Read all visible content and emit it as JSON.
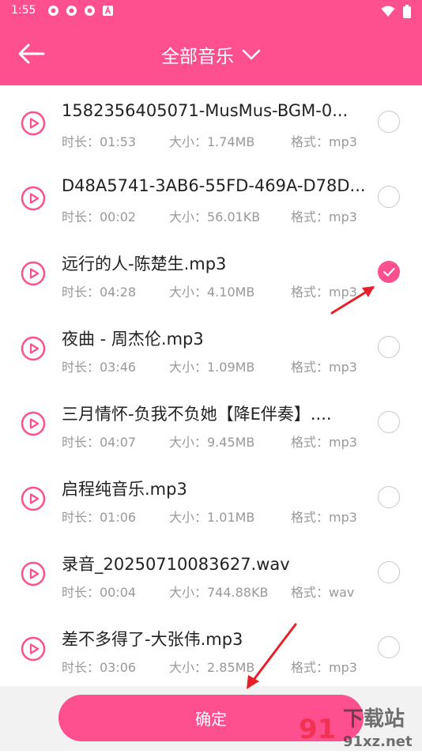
{
  "status_bar": {
    "time": "1:55"
  },
  "header": {
    "title": "全部音乐"
  },
  "songs": [
    {
      "name": "1582356405071-MusMus-BGM-0...",
      "duration_label": "时长：01:53",
      "size_label": "大小：1.74MB",
      "format_label": "格式：mp3",
      "checked": false
    },
    {
      "name": "D48A5741-3AB6-55FD-469A-D78D...",
      "duration_label": "时长：00:02",
      "size_label": "大小：56.01KB",
      "format_label": "格式：mp3",
      "checked": false
    },
    {
      "name": "远行的人-陈楚生.mp3",
      "duration_label": "时长：04:28",
      "size_label": "大小：4.10MB",
      "format_label": "格式：mp3",
      "checked": true
    },
    {
      "name": "夜曲 - 周杰伦.mp3",
      "duration_label": "时长：03:46",
      "size_label": "大小：1.09MB",
      "format_label": "格式：mp3",
      "checked": false
    },
    {
      "name": "三月情怀-负我不负她【降E伴奏】....",
      "duration_label": "时长：04:07",
      "size_label": "大小：9.45MB",
      "format_label": "格式：mp3",
      "checked": false
    },
    {
      "name": "启程纯音乐.mp3",
      "duration_label": "时长：01:06",
      "size_label": "大小：1.01MB",
      "format_label": "格式：mp3",
      "checked": false
    },
    {
      "name": "录音_20250710083627.wav",
      "duration_label": "时长：00:04",
      "size_label": "大小：744.88KB",
      "format_label": "格式：wav",
      "checked": false
    },
    {
      "name": "差不多得了-大张伟.mp3",
      "duration_label": "时长：03:06",
      "size_label": "大小：2.85MB",
      "format_label": "格式：mp3",
      "checked": false
    }
  ],
  "footer": {
    "confirm_label": "确定"
  },
  "watermark": {
    "text": "91下载站",
    "url": "91xz.net"
  },
  "colors": {
    "accent": "#fe4f8e",
    "annotation_arrow": "#e8202a"
  }
}
